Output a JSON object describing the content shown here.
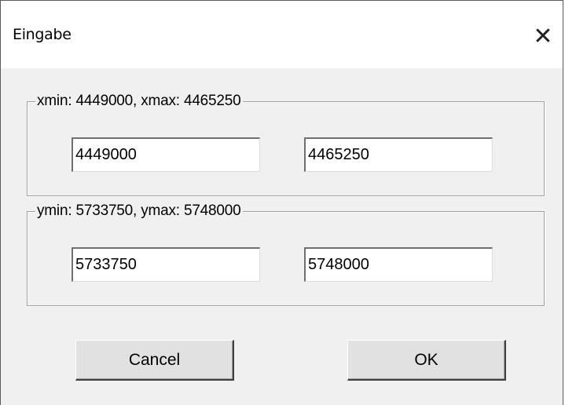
{
  "window": {
    "title": "Eingabe",
    "close_glyph": "✕"
  },
  "x_group": {
    "legend": "xmin: 4449000, xmax: 4465250",
    "min_value": "4449000",
    "max_value": "4465250"
  },
  "y_group": {
    "legend": "ymin: 5733750, ymax: 5748000",
    "min_value": "5733750",
    "max_value": "5748000"
  },
  "buttons": {
    "cancel_label": "Cancel",
    "ok_label": "OK"
  }
}
